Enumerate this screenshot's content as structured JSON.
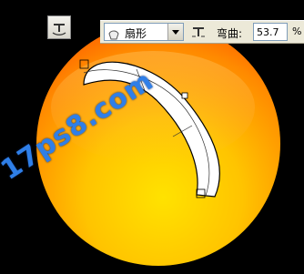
{
  "toolbar": {
    "warp_mode_icon": "warp-text-icon",
    "warp_style_icon": "arc-shape-icon",
    "warp_style_value": "扇形",
    "orientation_icon": "warp-orientation-icon",
    "bend_label": "弯曲:",
    "bend_value": "53.7",
    "bend_unit": "%"
  },
  "canvas": {
    "watermark": "17ps8.com",
    "colors": {
      "sphere_outer": "#ff7a00",
      "sphere_inner": "#ffd400",
      "background": "#000000",
      "watermark": "#2f7fe8"
    }
  }
}
